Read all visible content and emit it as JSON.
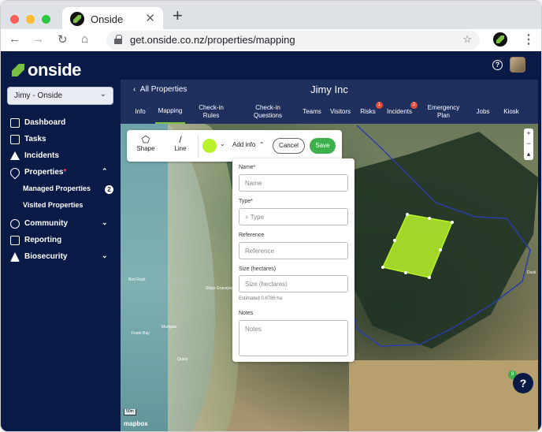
{
  "browser": {
    "tab_title": "Onside",
    "tab_close": "✕",
    "new_tab": "+",
    "url": "get.onside.co.nz/properties/mapping",
    "back": "←",
    "forward": "→",
    "reload": "↻",
    "home": "⌂",
    "star": "☆",
    "menu": "⋮"
  },
  "app": {
    "brand": "onside",
    "help_glyph": "?"
  },
  "sidebar": {
    "org_select": "Jimy - Onside",
    "chevron": "⌄",
    "items": [
      {
        "label": "Dashboard",
        "icon": "dashboard-icon"
      },
      {
        "label": "Tasks",
        "icon": "tasks-icon"
      },
      {
        "label": "Incidents",
        "icon": "incidents-icon"
      },
      {
        "label": "Properties",
        "icon": "properties-icon",
        "marker": "*",
        "chevron": "⌃"
      },
      {
        "label": "Community",
        "icon": "community-icon",
        "chevron": "⌄"
      },
      {
        "label": "Reporting",
        "icon": "reporting-icon"
      },
      {
        "label": "Biosecurity",
        "icon": "biosecurity-icon",
        "chevron": "⌄"
      }
    ],
    "sub_items": [
      {
        "label": "Managed Properties",
        "count": "2"
      },
      {
        "label": "Visited Properties"
      }
    ]
  },
  "header": {
    "back_label": "All Properties",
    "back_glyph": "‹",
    "title": "Jimy Inc",
    "tabs": [
      {
        "label": "Info"
      },
      {
        "label": "Mapping",
        "active": true
      },
      {
        "label": "Check-in Rules"
      },
      {
        "label": "Check-in Questions"
      },
      {
        "label": "Teams"
      },
      {
        "label": "Visitors"
      },
      {
        "label": "Risks",
        "badge": "1"
      },
      {
        "label": "Incidents",
        "badge": "2"
      },
      {
        "label": "Emergency Plan"
      },
      {
        "label": "Jobs"
      },
      {
        "label": "Kiosk"
      }
    ]
  },
  "map": {
    "zoom_in": "+",
    "zoom_out": "−",
    "compass": "▴",
    "places": [
      "Bird Rock",
      "Ships Graveyard",
      "Mudgate",
      "Frank Bay",
      "Quest"
    ],
    "right_label": "Dusk",
    "scale": "50m",
    "attribution": "mapbox",
    "parcel_color": "#b8f22a",
    "boundary_color": "#2a3ea8"
  },
  "draw_toolbar": {
    "shape_label": "Shape",
    "shape_glyph": "⬠",
    "line_label": "Line",
    "line_glyph": "/",
    "color": "#b8f22a",
    "color_chevron": "⌄",
    "add_info_label": "Add info",
    "add_info_chevron": "⌃",
    "cancel_label": "Cancel",
    "save_label": "Save"
  },
  "form": {
    "name_label": "Name*",
    "name_placeholder": "Name",
    "type_label": "Type*",
    "type_placeholder": "Type",
    "reference_label": "Reference",
    "reference_placeholder": "Reference",
    "size_label": "Size (hectares)",
    "size_placeholder": "Size (hectares)",
    "size_hint": "Estimated 0.6786 ha",
    "notes_label": "Notes",
    "notes_placeholder": "Notes"
  },
  "help_fab": {
    "glyph": "?",
    "badge": "9"
  }
}
